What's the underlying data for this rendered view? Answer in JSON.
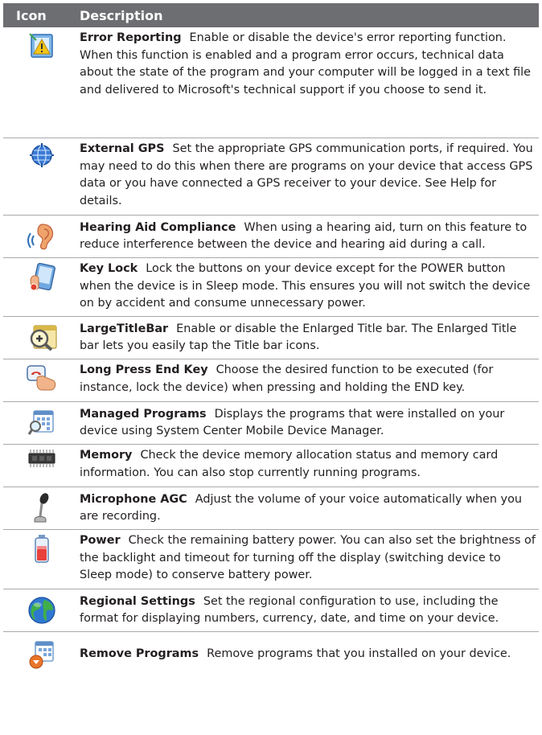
{
  "table": {
    "headers": {
      "icon": "Icon",
      "description": "Description"
    },
    "rows": [
      {
        "icon": "error-reporting-icon",
        "name": "Error Reporting",
        "text": "Enable or disable the device's error reporting function. When this function is enabled and a program error occurs, technical data about the state of the program and your computer will be logged in a text file and delivered to Microsoft's technical support if you choose to send it."
      },
      {
        "icon": "external-gps-icon",
        "name": "External GPS",
        "text": "Set the appropriate GPS communication ports, if required. You may need to do this when there are programs on your device that access GPS data or you have connected a GPS receiver to your device. See Help for details."
      },
      {
        "icon": "hearing-aid-icon",
        "name": "Hearing Aid Compliance",
        "text": "When using a hearing aid, turn on this feature to reduce interference between the device and hearing aid during a call."
      },
      {
        "icon": "key-lock-icon",
        "name": "Key Lock",
        "text": "Lock the buttons on your device except for the POWER button when the device is in Sleep mode. This ensures you will not switch the device on by accident and consume unnecessary power."
      },
      {
        "icon": "large-title-bar-icon",
        "name": "LargeTitleBar",
        "text": "Enable or disable the Enlarged Title bar. The Enlarged Title bar lets you easily tap the Title bar icons."
      },
      {
        "icon": "long-press-end-key-icon",
        "name": "Long Press End Key",
        "text": "Choose the desired function to be executed (for instance, lock the device) when pressing and holding the END key."
      },
      {
        "icon": "managed-programs-icon",
        "name": "Managed Programs",
        "text": "Displays the programs that were installed on your device using System Center Mobile Device Manager."
      },
      {
        "icon": "memory-icon",
        "name": "Memory",
        "text": "Check the device memory allocation status and memory card information. You can also stop currently running programs."
      },
      {
        "icon": "microphone-icon",
        "name": "Microphone AGC",
        "text": "Adjust the volume of your voice automatically when you are recording."
      },
      {
        "icon": "battery-icon",
        "name": "Power",
        "text": "Check the remaining battery power. You can also set the brightness of the backlight and timeout for turning off the display (switching device to Sleep mode) to conserve battery power."
      },
      {
        "icon": "globe-icon",
        "name": "Regional Settings",
        "text": "Set the regional configuration to use, including the format for displaying numbers, currency, date, and time on your device."
      },
      {
        "icon": "remove-programs-icon",
        "name": "Remove Programs",
        "text": "Remove programs that you installed on your device."
      }
    ]
  }
}
